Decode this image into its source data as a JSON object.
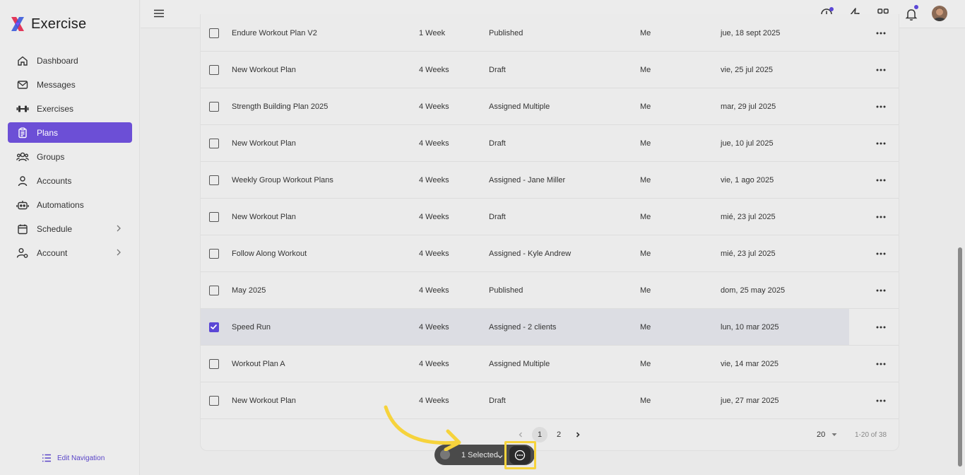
{
  "app": {
    "title": "Exercise"
  },
  "sidebar": {
    "items": [
      {
        "label": "Dashboard",
        "icon": "home-icon"
      },
      {
        "label": "Messages",
        "icon": "mail-icon"
      },
      {
        "label": "Exercises",
        "icon": "dumbbell-icon"
      },
      {
        "label": "Plans",
        "icon": "clipboard-icon",
        "active": true
      },
      {
        "label": "Groups",
        "icon": "users-icon"
      },
      {
        "label": "Accounts",
        "icon": "user-icon"
      },
      {
        "label": "Automations",
        "icon": "robot-icon"
      },
      {
        "label": "Schedule",
        "icon": "calendar-icon",
        "has_submenu": true
      },
      {
        "label": "Account",
        "icon": "user-settings-icon",
        "has_submenu": true
      }
    ],
    "edit_navigation": "Edit Navigation"
  },
  "topbar": {
    "icons": [
      "clock-icon",
      "lightning-icon",
      "apps-grid-icon",
      "bell-icon",
      "avatar"
    ]
  },
  "table": {
    "rows": [
      {
        "name": "Endure Workout Plan V2",
        "duration": "1 Week",
        "status": "Published",
        "owner": "Me",
        "date": "jue, 18 sept 2025",
        "checked": false
      },
      {
        "name": "New Workout Plan",
        "duration": "4 Weeks",
        "status": "Draft",
        "owner": "Me",
        "date": "vie, 25 jul 2025",
        "checked": false
      },
      {
        "name": "Strength Building Plan 2025",
        "duration": "4 Weeks",
        "status": "Assigned Multiple",
        "owner": "Me",
        "date": "mar, 29 jul 2025",
        "checked": false
      },
      {
        "name": "New Workout Plan",
        "duration": "4 Weeks",
        "status": "Draft",
        "owner": "Me",
        "date": "jue, 10 jul 2025",
        "checked": false
      },
      {
        "name": "Weekly Group Workout Plans",
        "duration": "4 Weeks",
        "status": "Assigned - Jane Miller",
        "owner": "Me",
        "date": "vie, 1 ago 2025",
        "checked": false
      },
      {
        "name": "New Workout Plan",
        "duration": "4 Weeks",
        "status": "Draft",
        "owner": "Me",
        "date": "mié, 23 jul 2025",
        "checked": false
      },
      {
        "name": "Follow Along Workout",
        "duration": "4 Weeks",
        "status": "Assigned - Kyle Andrew",
        "owner": "Me",
        "date": "mié, 23 jul 2025",
        "checked": false
      },
      {
        "name": "May 2025",
        "duration": "4 Weeks",
        "status": "Published",
        "owner": "Me",
        "date": "dom, 25 may 2025",
        "checked": false
      },
      {
        "name": "Speed Run",
        "duration": "4 Weeks",
        "status": "Assigned - 2 clients",
        "owner": "Me",
        "date": "lun, 10 mar 2025",
        "checked": true
      },
      {
        "name": "Workout Plan A",
        "duration": "4 Weeks",
        "status": "Assigned Multiple",
        "owner": "Me",
        "date": "vie, 14 mar 2025",
        "checked": false
      },
      {
        "name": "New Workout Plan",
        "duration": "4 Weeks",
        "status": "Draft",
        "owner": "Me",
        "date": "jue, 27 mar 2025",
        "checked": false
      }
    ]
  },
  "pagination": {
    "pages": [
      "1",
      "2"
    ],
    "current_page": "1",
    "per_page": "20",
    "range": "1-20 of 38"
  },
  "selection_bar": {
    "label": "1 Selected"
  },
  "colors": {
    "accent": "#6c4fd6",
    "highlight": "#f6d33c"
  }
}
